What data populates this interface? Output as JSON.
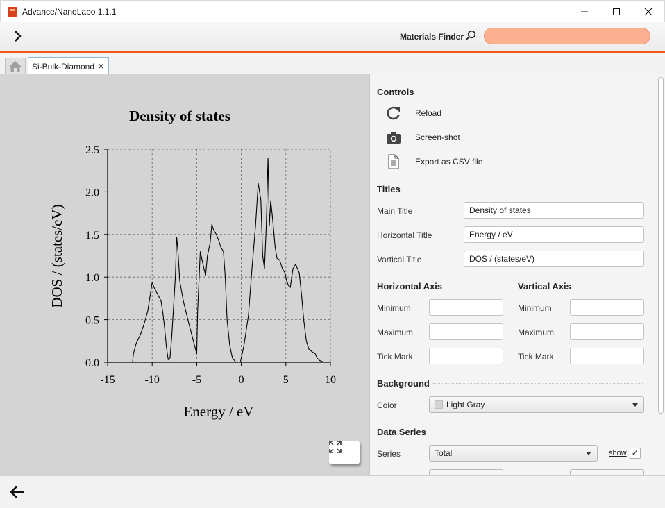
{
  "window": {
    "title": "Advance/NanoLabo 1.1.1",
    "buttons": [
      "minimize-icon",
      "maximize-icon",
      "close-icon"
    ]
  },
  "toolbar": {
    "finder_label": "Materials Finder",
    "finder_value": ""
  },
  "tabs": [
    {
      "icon": "home-icon"
    },
    {
      "label": "Si-Bulk-Diamond",
      "closable": true
    }
  ],
  "colors": {
    "accent": "#f25a14",
    "search_bg": "#fdb08f",
    "plot_bg": "#d4d4d4"
  },
  "chart_data": {
    "type": "line",
    "title": "Density of states",
    "xlabel": "Energy / eV",
    "ylabel": "DOS / (states/eV)",
    "xlim": [
      -15,
      10
    ],
    "ylim": [
      0,
      2.5
    ],
    "xticks": [
      "-15",
      "-10",
      "-5",
      "0",
      "5",
      "10"
    ],
    "yticks": [
      "0.0",
      "0.5",
      "1.0",
      "1.5",
      "2.0",
      "2.5"
    ],
    "grid": true,
    "series": [
      {
        "color": "#000000",
        "points": [
          [
            -12.2,
            0.0
          ],
          [
            -12.1,
            0.1
          ],
          [
            -11.8,
            0.22
          ],
          [
            -11.3,
            0.33
          ],
          [
            -10.9,
            0.45
          ],
          [
            -10.5,
            0.6
          ],
          [
            -10.2,
            0.8
          ],
          [
            -10.0,
            0.94
          ],
          [
            -9.8,
            0.88
          ],
          [
            -9.4,
            0.8
          ],
          [
            -9.0,
            0.72
          ],
          [
            -8.8,
            0.58
          ],
          [
            -8.6,
            0.4
          ],
          [
            -8.4,
            0.18
          ],
          [
            -8.2,
            0.03
          ],
          [
            -8.0,
            0.05
          ],
          [
            -7.8,
            0.3
          ],
          [
            -7.6,
            0.65
          ],
          [
            -7.4,
            1.0
          ],
          [
            -7.25,
            1.47
          ],
          [
            -7.1,
            1.3
          ],
          [
            -6.9,
            0.95
          ],
          [
            -6.5,
            0.72
          ],
          [
            -6.0,
            0.5
          ],
          [
            -5.5,
            0.3
          ],
          [
            -5.1,
            0.14
          ],
          [
            -5.0,
            0.1
          ],
          [
            -4.9,
            0.6
          ],
          [
            -4.6,
            1.3
          ],
          [
            -4.4,
            1.2
          ],
          [
            -4.2,
            1.1
          ],
          [
            -4.0,
            1.02
          ],
          [
            -3.8,
            1.25
          ],
          [
            -3.5,
            1.4
          ],
          [
            -3.3,
            1.62
          ],
          [
            -3.1,
            1.55
          ],
          [
            -2.8,
            1.5
          ],
          [
            -2.5,
            1.42
          ],
          [
            -2.3,
            1.35
          ],
          [
            -2.0,
            1.3
          ],
          [
            -1.8,
            1.0
          ],
          [
            -1.6,
            0.5
          ],
          [
            -1.3,
            0.2
          ],
          [
            -1.0,
            0.05
          ],
          [
            -0.6,
            0.0
          ],
          [
            -0.1,
            0.0
          ],
          [
            0.3,
            0.2
          ],
          [
            0.8,
            0.55
          ],
          [
            1.2,
            1.1
          ],
          [
            1.6,
            1.6
          ],
          [
            1.9,
            2.1
          ],
          [
            2.2,
            1.9
          ],
          [
            2.4,
            1.25
          ],
          [
            2.6,
            1.1
          ],
          [
            2.8,
            1.6
          ],
          [
            3.0,
            2.4
          ],
          [
            3.15,
            1.6
          ],
          [
            3.3,
            1.9
          ],
          [
            3.5,
            1.7
          ],
          [
            3.8,
            1.35
          ],
          [
            4.0,
            1.22
          ],
          [
            4.3,
            1.2
          ],
          [
            4.6,
            1.1
          ],
          [
            4.9,
            1.05
          ],
          [
            5.1,
            0.95
          ],
          [
            5.3,
            0.9
          ],
          [
            5.5,
            0.88
          ],
          [
            5.8,
            1.1
          ],
          [
            6.1,
            1.15
          ],
          [
            6.5,
            1.05
          ],
          [
            6.8,
            0.75
          ],
          [
            7.0,
            0.5
          ],
          [
            7.3,
            0.25
          ],
          [
            7.6,
            0.15
          ],
          [
            8.0,
            0.12
          ],
          [
            8.3,
            0.1
          ],
          [
            8.5,
            0.05
          ],
          [
            8.8,
            0.02
          ],
          [
            9.3,
            0.0
          ],
          [
            9.8,
            0.0
          ]
        ]
      }
    ]
  },
  "panel": {
    "controls": {
      "title": "Controls",
      "items": [
        {
          "icon": "reload-icon",
          "label": "Reload"
        },
        {
          "icon": "camera-icon",
          "label": "Screen-shot"
        },
        {
          "icon": "document-icon",
          "label": "Export as CSV file"
        }
      ]
    },
    "titles": {
      "title": "Titles",
      "main_label": "Main Title",
      "main_value": "Density of states",
      "horizontal_label": "Horizontal Title",
      "horizontal_value": "Energy / eV",
      "vertical_label": "Vartical Title",
      "vertical_value": "DOS / (states/eV)"
    },
    "horizontal_axis": {
      "title": "Horizontal Axis",
      "min_label": "Minimum",
      "min_value": "",
      "max_label": "Maximum",
      "max_value": "",
      "tick_label": "Tick Mark",
      "tick_value": ""
    },
    "vertical_axis": {
      "title": "Vartical Axis",
      "min_label": "Minimum",
      "min_value": "",
      "max_label": "Maximum",
      "max_value": "",
      "tick_label": "Tick Mark",
      "tick_value": ""
    },
    "background": {
      "title": "Background",
      "color_label": "Color",
      "color_value": "Light Gray",
      "swatch": "#d3d3d3"
    },
    "data_series": {
      "title": "Data Series",
      "series_label": "Series",
      "series_value": "Total",
      "show_label": "show",
      "show_checked": true
    }
  }
}
